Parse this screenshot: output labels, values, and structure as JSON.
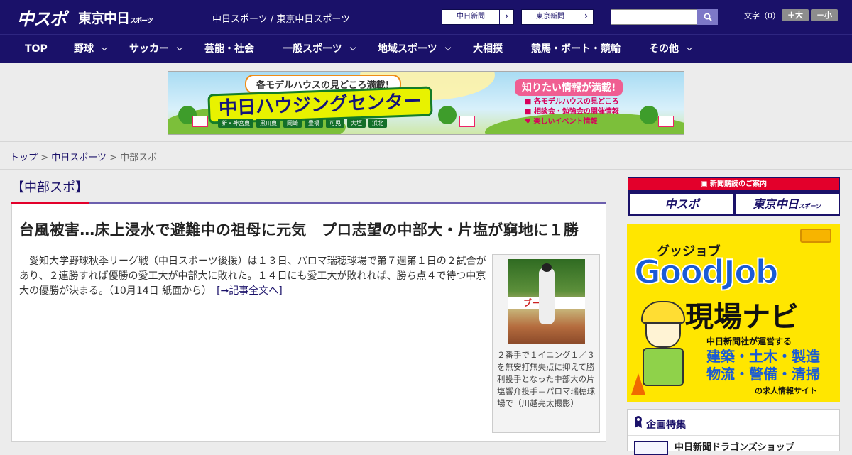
{
  "header": {
    "logo_main": "中スポ",
    "logo_tokyo": "東京中日",
    "logo_tokyo_small": "スポーツ",
    "site_title": "中日スポーツ / 東京中日スポーツ",
    "buttons": [
      {
        "label": "中日新聞"
      },
      {
        "label": "東京新聞"
      }
    ],
    "search_placeholder": "",
    "font_size_label": "文字（0）",
    "font_plus": "＋大",
    "font_minus": "－小"
  },
  "nav": {
    "items": [
      {
        "label": "TOP",
        "dropdown": false
      },
      {
        "label": "野球",
        "dropdown": true
      },
      {
        "label": "サッカー",
        "dropdown": true
      },
      {
        "label": "芸能・社会",
        "dropdown": false
      },
      {
        "label": "一般スポーツ",
        "dropdown": true
      },
      {
        "label": "地域スポーツ",
        "dropdown": true
      },
      {
        "label": "大相撲",
        "dropdown": false
      },
      {
        "label": "競馬・ボート・競輪",
        "dropdown": false
      },
      {
        "label": "その他",
        "dropdown": true
      }
    ]
  },
  "banner": {
    "tag": "各モデルハウスの見どころ満載!",
    "title": "中日ハウジングセンター",
    "towns": [
      "新・神宮東",
      "黒川東",
      "岡崎",
      "豊橋",
      "可児",
      "大垣",
      "浜北"
    ],
    "tag2": "知りたい情報が満載!",
    "list": [
      "各モデルハウスの見どころ",
      "相談会・勉強会の開催情報",
      "楽しいイベント情報"
    ]
  },
  "breadcrumb": {
    "items": [
      "トップ",
      "中日スポーツ",
      "中部スポ"
    ],
    "separator": " > "
  },
  "section": {
    "title": "【中部スポ】"
  },
  "article": {
    "headline": "台風被害…床上浸水で避難中の祖母に元気　プロ志望の中部大・片塩が窮地に１勝",
    "body": "　愛知大学野球秋季リーグ戦（中日スポーツ後援）は１３日、パロマ瑞穂球場で第７週第１日の２試合があり、２連勝すれば優勝の愛工大が中部大に敗れた。１４日にも愛工大が敗れれば、勝ち点４で待つ中京大の優勝が決まる。（10月14日 紙面から）　",
    "more_link": "[→記事全文へ]",
    "photo_ad_text": "ブー",
    "caption": "２番手で１イニング１／３を無安打無失点に抑えて勝利投手となった中部大の片塩響介投手＝パロマ瑞穂球場で（川越亮太撮影）"
  },
  "sidebar": {
    "subscribe_header": "新聞購読のご案内",
    "subscribe_buttons": [
      "中スポ",
      "東京中日"
    ],
    "subscribe_small": "スポーツ",
    "goodjob": {
      "kana": "グッジョブ",
      "name": "GoodJob",
      "title": "現場ナビ",
      "line1": "中日新聞社が運営する",
      "line2": "建築・土木・製造",
      "line3": "物流・警備・清掃",
      "line4": "の求人情報サイト"
    },
    "feature_title": "企画特集",
    "feature_item": "中日新聞ドラゴンズショップ"
  },
  "colors": {
    "navy": "#1a1169",
    "accent_red": "#e3002b",
    "purple_line": "#6c5fae",
    "goodjob_yellow": "#ffe600",
    "goodjob_blue": "#1a5bd6"
  }
}
